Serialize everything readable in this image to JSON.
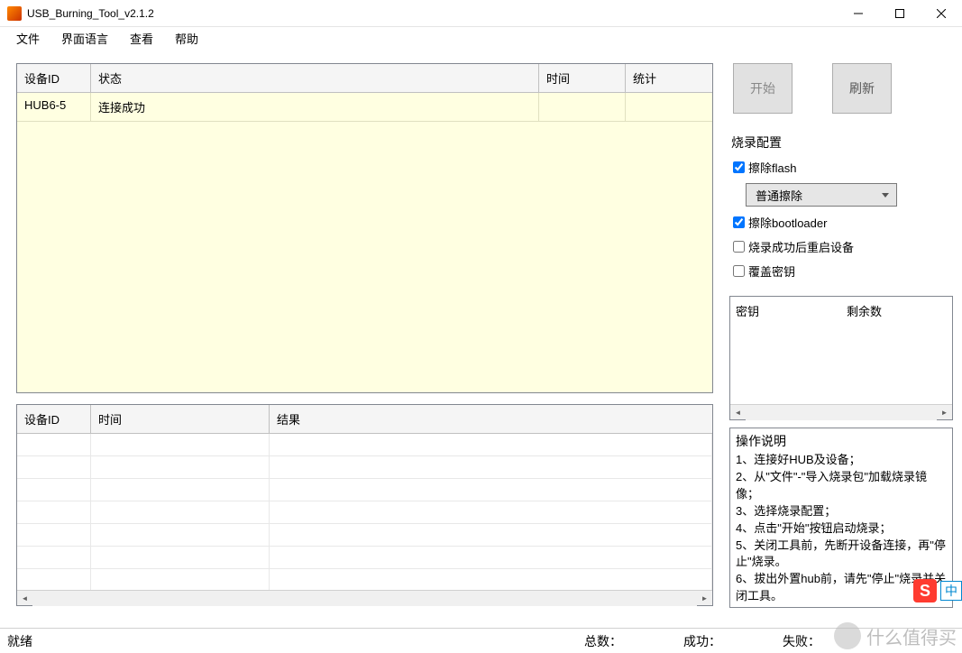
{
  "window": {
    "title": "USB_Burning_Tool_v2.1.2"
  },
  "menu": {
    "file": "文件",
    "language": "界面语言",
    "view": "查看",
    "help": "帮助"
  },
  "device_table": {
    "headers": {
      "id": "设备ID",
      "status": "状态",
      "time": "时间",
      "stat": "统计"
    },
    "row": {
      "id": "HUB6-5",
      "status": "连接成功",
      "time": "",
      "stat": ""
    }
  },
  "log_table": {
    "headers": {
      "id": "设备ID",
      "time": "时间",
      "result": "结果"
    }
  },
  "buttons": {
    "start": "开始",
    "refresh": "刷新"
  },
  "config": {
    "title": "烧录配置",
    "erase_flash": {
      "label": "擦除flash",
      "checked": true
    },
    "erase_mode": "普通擦除",
    "erase_bootloader": {
      "label": "擦除bootloader",
      "checked": true
    },
    "reboot_after": {
      "label": "烧录成功后重启设备",
      "checked": false
    },
    "overwrite_key": {
      "label": "覆盖密钥",
      "checked": false
    }
  },
  "key_table": {
    "headers": {
      "key": "密钥",
      "remaining": "剩余数"
    }
  },
  "instructions": {
    "title": "操作说明",
    "lines": [
      "1、连接好HUB及设备；",
      "2、从\"文件\"-\"导入烧录包\"加载烧录镜像；",
      "3、选择烧录配置；",
      "4、点击\"开始\"按钮启动烧录；",
      "5、关闭工具前，先断开设备连接，再\"停止\"烧录。",
      "6、拔出外置hub前，请先\"停止\"烧录并关闭工具。"
    ]
  },
  "statusbar": {
    "ready": "就绪",
    "total": "总数：",
    "success": "成功：",
    "fail": "失败："
  },
  "watermark": {
    "text": "什么值得买"
  },
  "ime": {
    "s": "S",
    "zh": "中"
  }
}
